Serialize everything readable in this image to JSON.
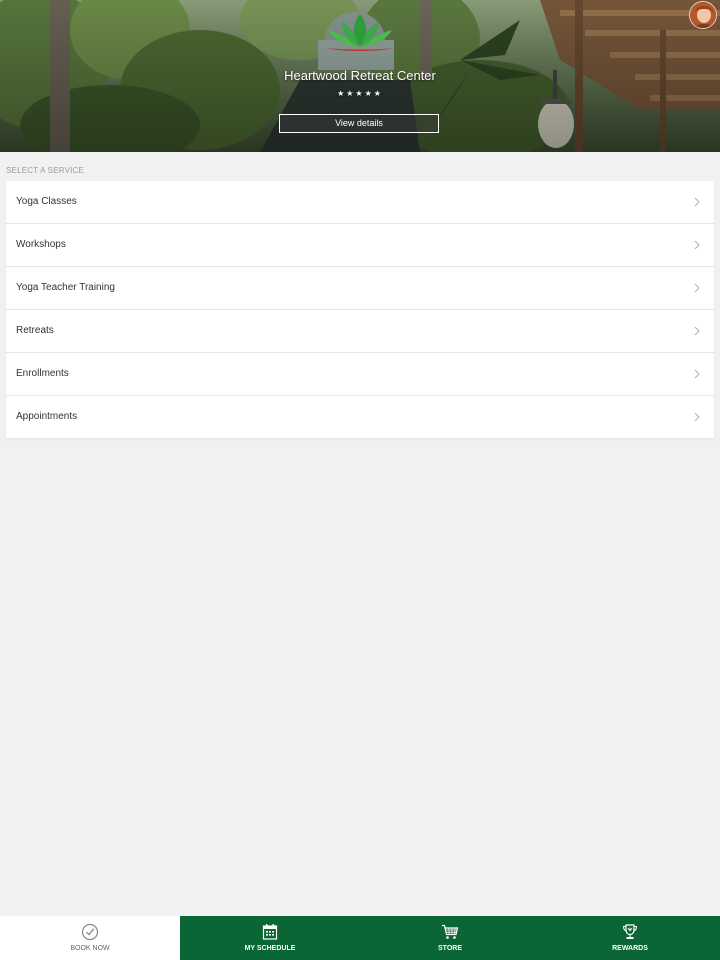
{
  "hero": {
    "title": "Heartwood Retreat Center",
    "rating_stars": "★★★★★",
    "view_details_label": "View details"
  },
  "services": {
    "section_label": "SELECT A SERVICE",
    "items": [
      {
        "label": "Yoga Classes"
      },
      {
        "label": "Workshops"
      },
      {
        "label": "Yoga Teacher Training"
      },
      {
        "label": "Retreats"
      },
      {
        "label": "Enrollments"
      },
      {
        "label": "Appointments"
      }
    ]
  },
  "bottom_nav": {
    "tabs": [
      {
        "label": "BOOK NOW",
        "icon": "check-circle-icon",
        "active": true
      },
      {
        "label": "MY SCHEDULE",
        "icon": "calendar-icon",
        "active": false
      },
      {
        "label": "STORE",
        "icon": "cart-icon",
        "active": false
      },
      {
        "label": "REWARDS",
        "icon": "trophy-icon",
        "active": false
      }
    ]
  },
  "colors": {
    "brand_green": "#0a6634",
    "logo_green": "#2e9a3a",
    "background": "#f1f1f1"
  }
}
